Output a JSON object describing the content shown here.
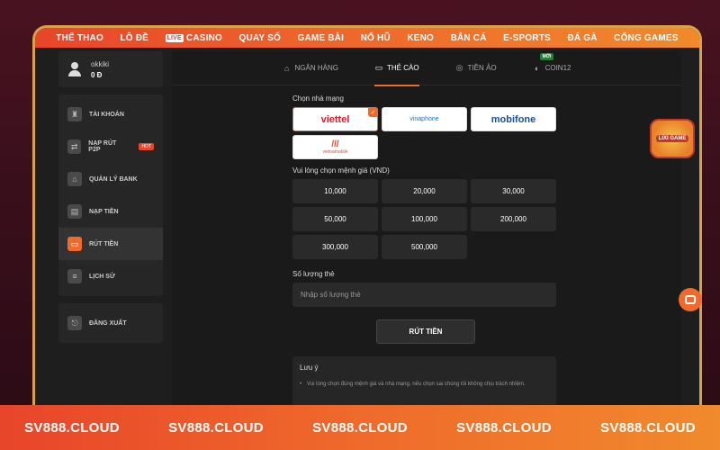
{
  "nav": {
    "items": [
      {
        "label": "THỂ THAO"
      },
      {
        "label": "LÔ ĐỀ"
      },
      {
        "label": "CASINO",
        "badge": "LIVE"
      },
      {
        "label": "QUAY SỐ"
      },
      {
        "label": "GAME BÀI"
      },
      {
        "label": "NỔ HŨ"
      },
      {
        "label": "KENO"
      },
      {
        "label": "BẮN CÁ"
      },
      {
        "label": "E-SPORTS"
      },
      {
        "label": "ĐÁ GÀ"
      },
      {
        "label": "CỔNG GAMES"
      }
    ]
  },
  "user": {
    "name": "okkiki",
    "balance": "0 Đ"
  },
  "sidebar": {
    "items": [
      {
        "label": "TÀI KHOẢN",
        "icon": "account-icon"
      },
      {
        "label": "NẠP RÚT P2P",
        "icon": "p2p-icon",
        "badge": "HOT"
      },
      {
        "label": "QUẢN LÝ BANK",
        "icon": "bank-icon"
      },
      {
        "label": "NẠP TIỀN",
        "icon": "deposit-icon"
      },
      {
        "label": "RÚT TIỀN",
        "icon": "withdraw-icon",
        "active": true
      },
      {
        "label": "LỊCH SỬ",
        "icon": "history-icon"
      }
    ],
    "logout": "ĐĂNG XUẤT"
  },
  "tabs": [
    {
      "label": "NGÂN HÀNG",
      "icon": "bank-icon"
    },
    {
      "label": "THẺ CÀO",
      "icon": "card-icon",
      "active": true
    },
    {
      "label": "TIỀN ẢO",
      "icon": "crypto-icon"
    },
    {
      "label": "COIN12",
      "icon": "coin-icon",
      "badge": "MỚI"
    }
  ],
  "form": {
    "carrier_label": "Chọn nhà mạng",
    "carriers": [
      {
        "name": "viettel",
        "selected": true
      },
      {
        "name": "vinaphone"
      },
      {
        "name": "mobifone"
      },
      {
        "name": "vietnamobile"
      }
    ],
    "amount_label": "Vui lòng chọn mệnh giá (VND)",
    "amounts": [
      "10,000",
      "20,000",
      "30,000",
      "50,000",
      "100,000",
      "200,000",
      "300,000",
      "500,000"
    ],
    "quantity_label": "Số lượng thẻ",
    "quantity_placeholder": "Nhập số lượng thẻ",
    "submit_label": "RÚT TIỀN",
    "note_title": "Lưu ý",
    "note_text": "Vui lòng chọn đúng mệnh giá và nhà mạng, nếu chọn sai chúng tôi không chịu trách nhiệm."
  },
  "banner": {
    "text": "SV888.CLOUD",
    "repeat": 5
  },
  "game_badge": "LIXI GAME",
  "colors": {
    "accent": "#ef6a2b",
    "brand_red": "#e8452a",
    "frame_gold": "#d9a24a"
  }
}
